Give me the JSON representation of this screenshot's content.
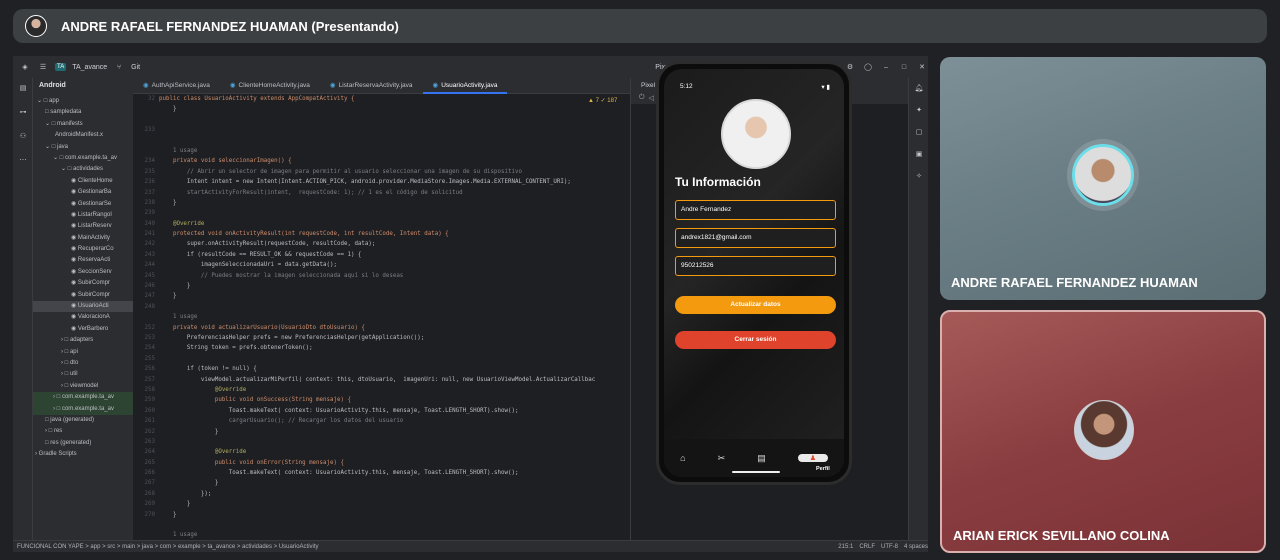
{
  "meet": {
    "presenter": "ANDRE RAFAEL FERNANDEZ HUAMAN (Presentando)",
    "tiles": [
      {
        "name": "ANDRE RAFAEL FERNANDEZ HUAMAN"
      },
      {
        "name": "ARIAN ERICK SEVILLANO COLINA"
      }
    ]
  },
  "ide": {
    "project_badge": "TA",
    "project": "TA_avance",
    "vcs": "Git",
    "device": "Pixel 4",
    "run_config": "app",
    "panel_label": "Android",
    "tabs": [
      "AuthApiService.java",
      "ClienteHomeActivity.java",
      "ListarReservaActivity.java",
      "UsuarioActivity.java"
    ],
    "active_tab": 3,
    "warnings": "▲ 7  ✓ 187",
    "device_tab": "Pixel 4 API 36",
    "tree": [
      {
        "t": "⌄ □ app",
        "ind": 4
      },
      {
        "t": "□ sampledata",
        "ind": 12
      },
      {
        "t": "⌄ □ manifests",
        "ind": 12
      },
      {
        "t": "AndroidManifest.x",
        "ind": 22
      },
      {
        "t": "⌄ □ java",
        "ind": 12
      },
      {
        "t": "⌄ □ com.example.ta_av",
        "ind": 20
      },
      {
        "t": "⌄ □ actividades",
        "ind": 28
      },
      {
        "t": "◉ ClienteHome",
        "ind": 38
      },
      {
        "t": "◉ GestionarBa",
        "ind": 38
      },
      {
        "t": "◉ GestionarSe",
        "ind": 38
      },
      {
        "t": "◉ ListarRangoI",
        "ind": 38
      },
      {
        "t": "◉ ListarReserv",
        "ind": 38
      },
      {
        "t": "◉ MainActivity",
        "ind": 38
      },
      {
        "t": "◉ RecuperarCo",
        "ind": 38
      },
      {
        "t": "◉ ReservaActi",
        "ind": 38
      },
      {
        "t": "◉ SeccionServ",
        "ind": 38
      },
      {
        "t": "◉ SubirCompr",
        "ind": 38
      },
      {
        "t": "◉ SubirCompr",
        "ind": 38
      },
      {
        "t": "◉ UsuarioActi",
        "ind": 38
      },
      {
        "t": "◉ ValoracionA",
        "ind": 38
      },
      {
        "t": "◉ VerBarbero",
        "ind": 38
      },
      {
        "t": "› □ adapters",
        "ind": 28
      },
      {
        "t": "› □ api",
        "ind": 28
      },
      {
        "t": "› □ dto",
        "ind": 28
      },
      {
        "t": "› □ util",
        "ind": 28
      },
      {
        "t": "› □ viewmodel",
        "ind": 28
      },
      {
        "t": "› □ com.example.ta_av",
        "ind": 20
      },
      {
        "t": "› □ com.example.ta_av",
        "ind": 20
      },
      {
        "t": "□ java (generated)",
        "ind": 12
      },
      {
        "t": "› □ res",
        "ind": 12
      },
      {
        "t": "□ res (generated)",
        "ind": 12
      },
      {
        "t": "› Gradle Scripts",
        "ind": 2
      }
    ],
    "tree_selected": 18,
    "tree_highlight": [
      26,
      27
    ],
    "code": [
      {
        "n": "32",
        "t": "public class UsuarioActivity extends AppCompatActivity {"
      },
      {
        "n": "",
        "t": "    }"
      },
      {
        "n": "",
        "t": ""
      },
      {
        "n": "233",
        "t": ""
      },
      {
        "n": "",
        "t": ""
      },
      {
        "n": "",
        "t": "    1 usage"
      },
      {
        "n": "234",
        "t": "    private void seleccionarImagen() {"
      },
      {
        "n": "235",
        "t": "        // Abrir un selector de imagen para permitir al usuario seleccionar una imagen de su dispositivo"
      },
      {
        "n": "236",
        "t": "        Intent intent = new Intent(Intent.ACTION_PICK, android.provider.MediaStore.Images.Media.EXTERNAL_CONTENT_URI);"
      },
      {
        "n": "237",
        "t": "        startActivityForResult(intent,  requestCode: 1); // 1 es el código de solicitud"
      },
      {
        "n": "238",
        "t": "    }"
      },
      {
        "n": "239",
        "t": ""
      },
      {
        "n": "240",
        "t": "    @Override"
      },
      {
        "n": "241",
        "t": "    protected void onActivityResult(int requestCode, int resultCode, Intent data) {"
      },
      {
        "n": "242",
        "t": "        super.onActivityResult(requestCode, resultCode, data);"
      },
      {
        "n": "243",
        "t": "        if (resultCode == RESULT_OK && requestCode == 1) {"
      },
      {
        "n": "244",
        "t": "            imagenSeleccionadaUri = data.getData();"
      },
      {
        "n": "245",
        "t": "            // Puedes mostrar la imagen seleccionada aquí si lo deseas"
      },
      {
        "n": "246",
        "t": "        }"
      },
      {
        "n": "247",
        "t": "    }"
      },
      {
        "n": "248",
        "t": ""
      },
      {
        "n": "",
        "t": "    1 usage"
      },
      {
        "n": "252",
        "t": "    private void actualizarUsuario(UsuarioDto dtoUsuario) {"
      },
      {
        "n": "253",
        "t": "        PreferenciasHelper prefs = new PreferenciasHelper(getApplication());"
      },
      {
        "n": "254",
        "t": "        String token = prefs.obtenerToken();"
      },
      {
        "n": "255",
        "t": ""
      },
      {
        "n": "256",
        "t": "        if (token != null) {"
      },
      {
        "n": "257",
        "t": "            viewModel.actualizarMiPerfil( context: this, dtoUsuario,  imagenUri: null, new UsuarioViewModel.ActualizarCallbac"
      },
      {
        "n": "258",
        "t": "                @Override"
      },
      {
        "n": "259",
        "t": "                public void onSuccess(String mensaje) {"
      },
      {
        "n": "260",
        "t": "                    Toast.makeText( context: UsuarioActivity.this, mensaje, Toast.LENGTH_SHORT).show();"
      },
      {
        "n": "261",
        "t": "                    cargarUsuario(); // Recargar los datos del usuario"
      },
      {
        "n": "262",
        "t": "                }"
      },
      {
        "n": "263",
        "t": ""
      },
      {
        "n": "264",
        "t": "                @Override"
      },
      {
        "n": "265",
        "t": "                public void onError(String mensaje) {"
      },
      {
        "n": "266",
        "t": "                    Toast.makeText( context: UsuarioActivity.this, mensaje, Toast.LENGTH_SHORT).show();"
      },
      {
        "n": "267",
        "t": "                }"
      },
      {
        "n": "268",
        "t": "            });"
      },
      {
        "n": "269",
        "t": "        }"
      },
      {
        "n": "270",
        "t": "    }"
      },
      {
        "n": "",
        "t": ""
      },
      {
        "n": "",
        "t": "    1 usage"
      }
    ],
    "status": {
      "breadcrumb": "FUNCIONAL CON YAPE  >  app  >  src  >  main  >  java  >  com  >  example  >  ta_avance  >  actividades  >  UsuarioActivity",
      "position": "215:1",
      "line_sep": "CRLF",
      "encoding": "UTF-8",
      "indent": "4 spaces"
    }
  },
  "phone": {
    "time": "5:12",
    "title": "Tu Información",
    "name_value": "Andre Fernandez",
    "email_value": "andrex1821@gmail.com",
    "phone_value": "950212526",
    "update_button": "Actualizar datos",
    "logout_button": "Cerrar sesión",
    "nav_profile": "Perfil",
    "colors": {
      "accent": "#f39a0f",
      "logout": "#e0432c"
    }
  }
}
